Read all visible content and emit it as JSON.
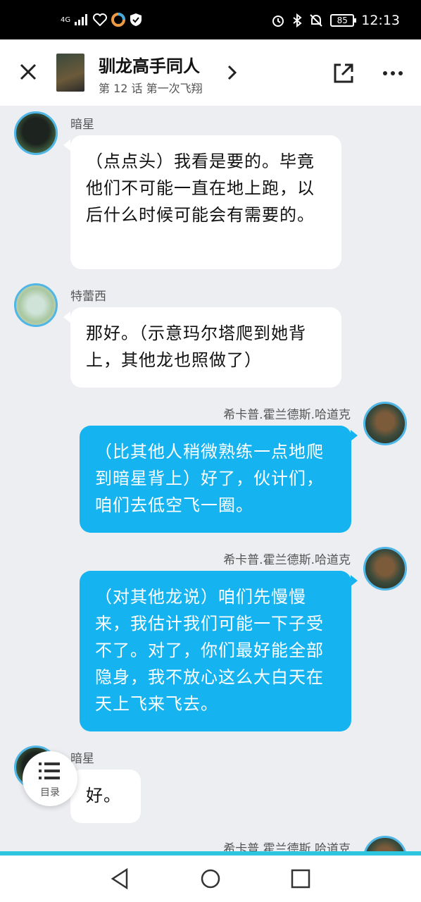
{
  "status_bar": {
    "network": "4G",
    "battery": "85",
    "time": "12:13",
    "icons_left": [
      "signal-icon",
      "health-icon",
      "app-icon",
      "shield-icon"
    ],
    "icons_right": [
      "alarm-icon",
      "bluetooth-icon",
      "mute-icon",
      "battery-icon"
    ]
  },
  "header": {
    "title": "驯龙高手同人",
    "subtitle": "第 12 话 第一次飞翔"
  },
  "messages": [
    {
      "side": "left",
      "sender": "暗星",
      "avatar": "dragon",
      "text": "（点点头）我看是要的。毕竟他们不可能一直在地上跑，以后什么时候可能会有需要的。"
    },
    {
      "side": "left",
      "sender": "特蕾西",
      "avatar": "tracy",
      "text": "那好。（示意玛尔塔爬到她背上，其他龙也照做了）"
    },
    {
      "side": "right",
      "sender": "希卡普.霍兰德斯.哈道克",
      "avatar": "hiccup",
      "text": "（比其他人稍微熟练一点地爬到暗星背上）好了，伙计们，咱们去低空飞一圈。"
    },
    {
      "side": "right",
      "sender": "希卡普.霍兰德斯.哈道克",
      "avatar": "hiccup",
      "text": "（对其他龙说）咱们先慢慢来，我估计我们可能一下子受不了。对了，你们最好能全部隐身，我不放心这么大白天在天上飞来飞去。"
    },
    {
      "side": "left",
      "sender": "暗星",
      "avatar": "dragon",
      "text": "好。"
    },
    {
      "side": "right",
      "sender": "希卡普.霍兰德斯.哈道克",
      "avatar": "hiccup",
      "text": ""
    }
  ],
  "toc": {
    "label": "目录"
  },
  "colors": {
    "accent": "#15b4f0",
    "progress": "#2ec5e0"
  }
}
